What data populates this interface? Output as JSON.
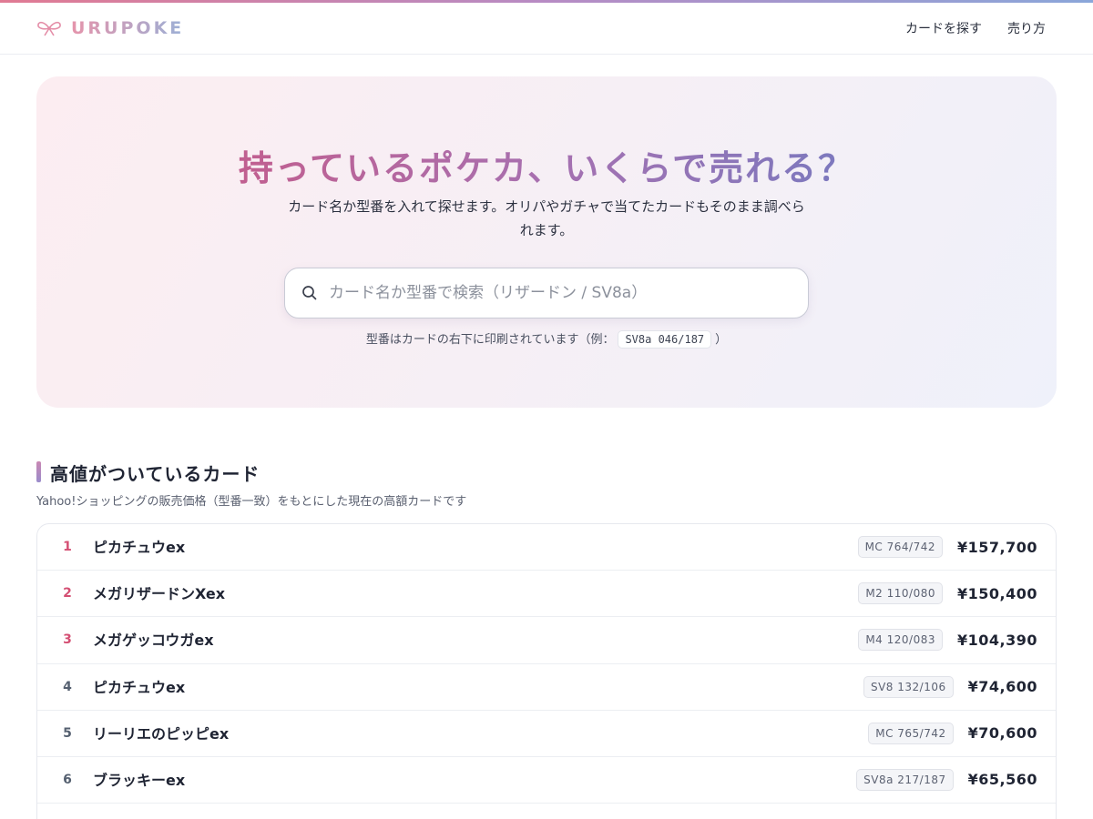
{
  "header": {
    "logo_text": "URUPOKE",
    "nav": [
      "カードを探す",
      "売り方"
    ]
  },
  "hero": {
    "title": "持っているポケカ、いくらで売れる？",
    "subtitle": "カード名か型番を入れて探せます。オリパやガチャで当てたカードもそのまま調べられます。",
    "search_placeholder": "カード名か型番で検索（リザードン / SV8a）",
    "hint_prefix": "型番はカードの右下に印刷されています（例：",
    "hint_code": "SV8a 046/187",
    "hint_suffix": "）"
  },
  "section": {
    "title": "高値がついているカード",
    "subtitle": "Yahoo!ショッピングの販売価格（型番一致）をもとにした現在の高額カードです"
  },
  "cards": [
    {
      "rank": "1",
      "name": "ピカチュウex",
      "model": "MC 764/742",
      "price": "¥157,700"
    },
    {
      "rank": "2",
      "name": "メガリザードンXex",
      "model": "M2 110/080",
      "price": "¥150,400"
    },
    {
      "rank": "3",
      "name": "メガゲッコウガex",
      "model": "M4 120/083",
      "price": "¥104,390"
    },
    {
      "rank": "4",
      "name": "ピカチュウex",
      "model": "SV8 132/106",
      "price": "¥74,600"
    },
    {
      "rank": "5",
      "name": "リーリエのピッピex",
      "model": "MC 765/742",
      "price": "¥70,600"
    },
    {
      "rank": "6",
      "name": "ブラッキーex",
      "model": "SV8a 217/187",
      "price": "¥65,560"
    }
  ]
}
